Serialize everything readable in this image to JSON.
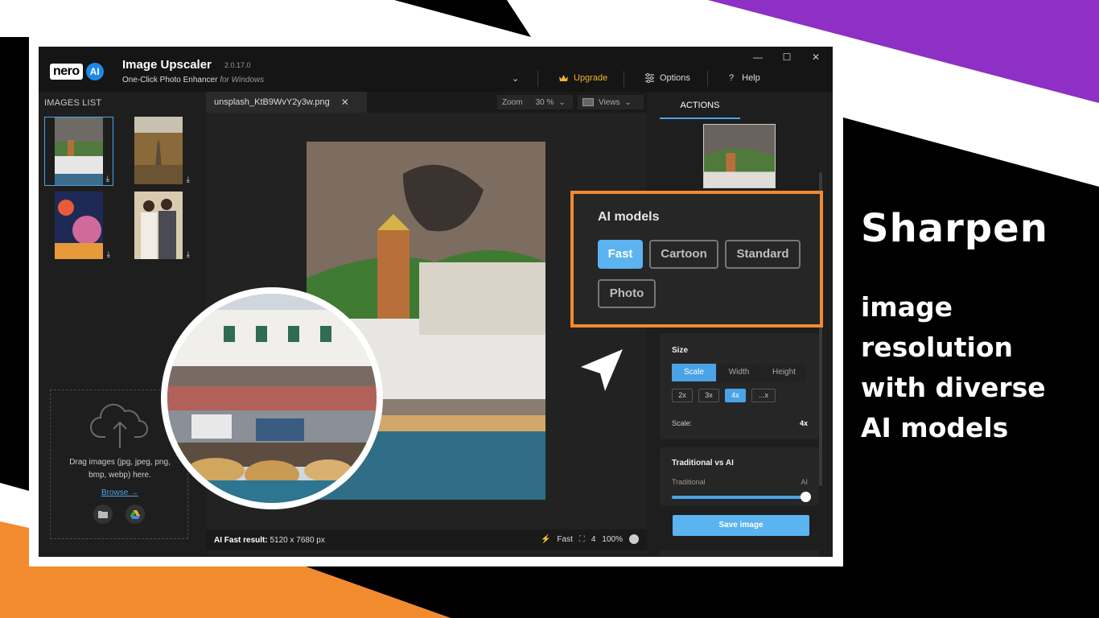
{
  "app": {
    "logo_text": "nero",
    "logo_ai": "AI",
    "title": "Image Upscaler",
    "version": "2.0.17.0",
    "subtitle_main": "One-Click Photo Enhancer",
    "subtitle_platform": "for Windows",
    "window_controls": {
      "minimize": "—",
      "maximize": "☐",
      "close": "✕"
    }
  },
  "toolbar": {
    "dropdown": "⌄",
    "upgrade": "Upgrade",
    "options": "Options",
    "help": "Help",
    "help_glyph": "?"
  },
  "images_list": {
    "title": "IMAGES LIST",
    "download_glyph": "⤓",
    "drop_text_1": "Drag images (jpg, jpeg, png,",
    "drop_text_2": "bmp, webp) here.",
    "browse": "Browse →"
  },
  "center": {
    "file_tab": "unsplash_KtB9WvY2y3w.png",
    "close_glyph": "✕",
    "zoom_label": "Zoom",
    "zoom_value": "30 %",
    "views_label": "Views",
    "status_label": "AI Fast result:",
    "status_value": "5120 x 7680 px",
    "status_mode": "Fast",
    "status_count": "4",
    "status_zoom": "100%"
  },
  "right_panel": {
    "actions_tab": "ACTIONS",
    "size_title": "Size",
    "seg_scale": "Scale",
    "seg_width": "Width",
    "seg_height": "Height",
    "mult": [
      "2x",
      "3x",
      "4x",
      "...x"
    ],
    "scale_label": "Scale:",
    "scale_value": "4x",
    "trad_title": "Traditional vs AI",
    "trad_left": "Traditional",
    "trad_right": "AI",
    "trad_value": 1.0,
    "save": "Save image"
  },
  "ai_models": {
    "title": "AI models",
    "models": [
      "Fast",
      "Cartoon",
      "Standard",
      "Photo"
    ],
    "selected": "Fast"
  },
  "promo": {
    "title": "Sharpen",
    "lines": [
      "image",
      "resolution",
      "with diverse",
      "AI models"
    ]
  },
  "colors": {
    "accent": "#5bb3f0",
    "highlight": "#f28a2e",
    "upgrade": "#f2b233",
    "purple": "#8e2fc6"
  },
  "icons": {
    "upgrade": "crown-icon",
    "options": "sliders-icon",
    "help": "question-icon",
    "cloud": "cloud-upload-icon",
    "folder": "folder-icon",
    "drive": "google-drive-icon",
    "cursor": "pointer-arrow-icon"
  }
}
